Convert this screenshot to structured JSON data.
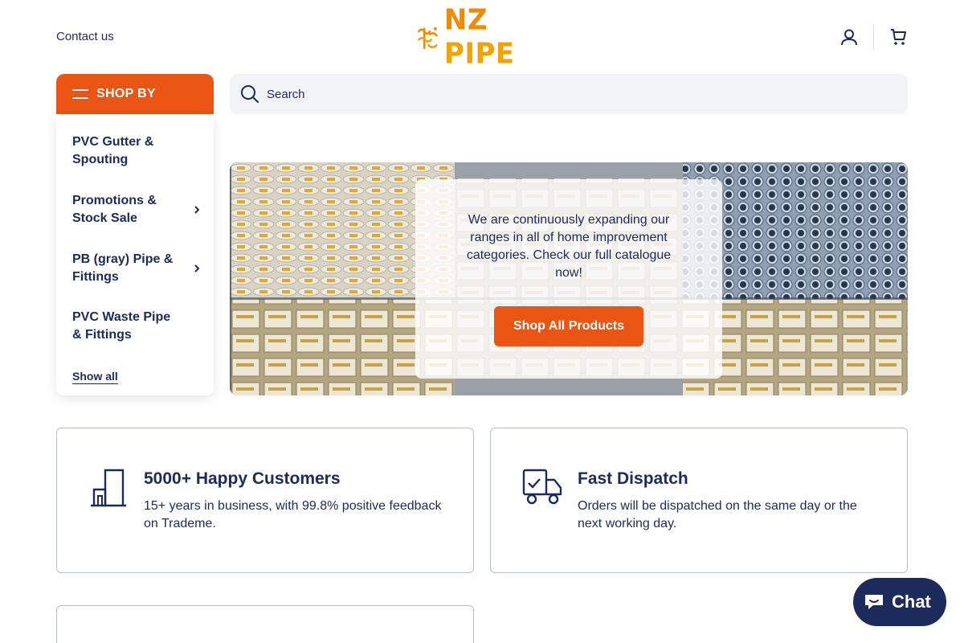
{
  "header": {
    "contact_label": "Contact us",
    "logo_text_nz": "NZ",
    "logo_text_pipe": "PIPE",
    "account_icon": "user-icon",
    "cart_icon": "cart-icon"
  },
  "sidebar": {
    "shop_by_label": "SHOP BY",
    "items": [
      {
        "label": "PVC Gutter & Spouting",
        "has_submenu": false
      },
      {
        "label": "Promotions & Stock Sale",
        "has_submenu": true
      },
      {
        "label": "PB (gray) Pipe & Fittings",
        "has_submenu": true
      },
      {
        "label": "PVC Waste Pipe & Fittings",
        "has_submenu": false
      }
    ],
    "show_all_label": "Show all"
  },
  "search": {
    "placeholder": "Search",
    "value": ""
  },
  "hero": {
    "text": "We are continuously expanding our ranges in all of home improvement categories. Check our full catalogue now!",
    "button_label": "Shop All Products"
  },
  "features": [
    {
      "icon": "warehouse-icon",
      "title": "5000+ Happy Customers",
      "description": "15+ years in business, with 99.8% positive feedback on Trademe."
    },
    {
      "icon": "delivery-truck-icon",
      "title": "Fast Dispatch",
      "description": "Orders will be dispatched on the same day or the next working day."
    }
  ],
  "chat": {
    "label": "Chat"
  },
  "colors": {
    "brand_orange": "#ea5514",
    "navy": "#1c2a5c",
    "logo_yellow": "#f3a300"
  }
}
